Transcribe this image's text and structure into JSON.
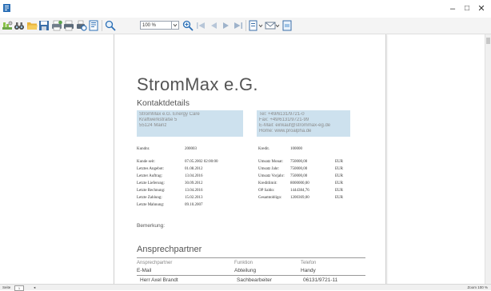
{
  "window": {
    "minimize": "–",
    "maximize": "□",
    "close": "✕"
  },
  "toolbar": {
    "zoom_value": "100 %",
    "icons": [
      "search-icon",
      "binoculars-icon",
      "open-folder-icon",
      "save-icon",
      "print-settings-icon",
      "printer-icon",
      "print-preview-icon",
      "page-setup-icon",
      "zoom-icon",
      "first-page-icon",
      "previous-page-icon",
      "next-page-icon",
      "last-page-icon",
      "export-icon",
      "email-icon",
      "watermark-icon"
    ]
  },
  "report": {
    "company": "StromMax e.G.",
    "kontaktdetails": "Kontaktdetails",
    "address_left": [
      "StromMax e.G. Energy Care",
      "Kraftwerkstraße 5",
      "55124 Mainz"
    ],
    "address_right": [
      "Tel: +49/6131/9721-0",
      "Fax: +49/6131/9721-99",
      "E-Mail: einkauf@strommax-eg.de",
      "Home: www.proalpha.de"
    ],
    "kundnr_label": "Kundnr.",
    "kundnr_value": "200003",
    "kreditor_label": "Kredit.",
    "kreditor_value": "100000",
    "left_fields": [
      {
        "label": "Kunde seit:",
        "value": "07.05.2002 02:00:00"
      },
      {
        "label": "Letztes Angebot:",
        "value": "01.08.2012"
      },
      {
        "label": "Letzter Auftrag:",
        "value": "13.04.2016"
      },
      {
        "label": "Letzte Lieferung:",
        "value": "30.09.2012"
      },
      {
        "label": "Letzte Rechnung:",
        "value": "13.04.2016"
      },
      {
        "label": "Letzte Zahlung:",
        "value": "15.02.2013"
      },
      {
        "label": "Letzte Mahnung:",
        "value": "09.10.2007"
      }
    ],
    "right_fields": [
      {
        "label": "Umsatz Monat:",
        "value": "750000,00",
        "unit": "EUR"
      },
      {
        "label": "Umsatz Jahr:",
        "value": "750000,00",
        "unit": "EUR"
      },
      {
        "label": "Umsatz Vorjahr:",
        "value": "750000,00",
        "unit": "EUR"
      },
      {
        "label": "Kreditlimit:",
        "value": "8000000,00",
        "unit": "EUR"
      },
      {
        "label": "OP Saldo:",
        "value": "1444384,76",
        "unit": "EUR"
      },
      {
        "label": "Gesamtobligo:",
        "value": "1200369,00",
        "unit": "EUR"
      }
    ],
    "bemerkung": "Bemerkung:",
    "ansprechpartner_title": "Ansprechpartner",
    "table_headers": {
      "ansprechpartner": "Ansprechpartner",
      "funktion": "Funktion",
      "telefon": "Telefon",
      "email": "E-Mail",
      "abteilung": "Abteilung",
      "handy": "Handy"
    },
    "contact": {
      "name": "Herr Axel Brandt",
      "abteilung": "Sachbearbeiter",
      "telefon": "06131/9721-11"
    }
  },
  "status": {
    "page_label": "Seite",
    "page_value": "1",
    "right_text": "Zoom 100 %"
  }
}
